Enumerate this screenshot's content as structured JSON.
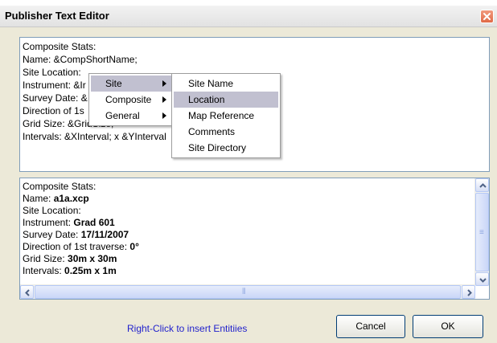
{
  "window": {
    "title": "Publisher Text Editor"
  },
  "editor": {
    "lines": [
      "Composite Stats:",
      "Name: &CompShortName;",
      "Site Location:",
      "Instrument: &Ir",
      "Survey Date: &",
      "Direction of 1s",
      "Grid Size: &GridSize;",
      "Intervals: &XInterval; x &YInterval"
    ]
  },
  "context_menu": {
    "items": [
      {
        "label": "Site",
        "has_submenu": true,
        "selected": true
      },
      {
        "label": "Composite",
        "has_submenu": true
      },
      {
        "label": "General",
        "has_submenu": true
      }
    ],
    "submenu": [
      {
        "label": "Site Name"
      },
      {
        "label": "Location",
        "selected": true
      },
      {
        "label": "Map Reference"
      },
      {
        "label": "Comments"
      },
      {
        "label": "Site Directory"
      }
    ]
  },
  "preview": {
    "lines": [
      {
        "label": "Composite Stats:",
        "value": ""
      },
      {
        "label": "Name: ",
        "value": "a1a.xcp"
      },
      {
        "label": "Site Location:",
        "value": ""
      },
      {
        "label": "Instrument: ",
        "value": "Grad 601"
      },
      {
        "label": "Survey Date: ",
        "value": "17/11/2007"
      },
      {
        "label": "Direction of 1st traverse: ",
        "value": "0°"
      },
      {
        "label": "Grid Size: ",
        "value": "30m x 30m"
      },
      {
        "label": "Intervals: ",
        "value": "0.25m x 1m"
      }
    ]
  },
  "footer": {
    "hint": "Right-Click to insert Entitiies",
    "cancel_label": "Cancel",
    "ok_label": "OK"
  },
  "icons": {
    "close": "close-icon",
    "submenu_arrow": "chevron-right-icon",
    "scroll_up": "chevron-up-icon",
    "scroll_down": "chevron-down-icon",
    "scroll_left": "chevron-left-icon",
    "scroll_right": "chevron-right-icon"
  },
  "colors": {
    "hint": "#1f1fcc",
    "menu_selected": "#c1c0d0",
    "close_button": "#e06a47"
  }
}
